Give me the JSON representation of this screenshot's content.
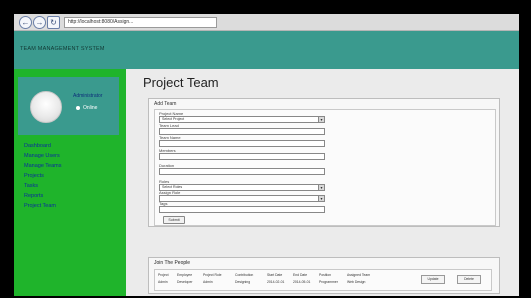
{
  "browser": {
    "address": "http://localhost:8080/Assign..."
  },
  "header": {
    "title": "TEAM MANAGEMENT SYSTEM"
  },
  "sidebar": {
    "profile": {
      "name": "Administrator",
      "status": "Online"
    },
    "items": [
      {
        "label": "Dashboard"
      },
      {
        "label": "Manage Users"
      },
      {
        "label": "Manage Teams"
      },
      {
        "label": "Projects"
      },
      {
        "label": "Tasks"
      },
      {
        "label": "Reports"
      },
      {
        "label": "Project Team"
      }
    ]
  },
  "main": {
    "title": "Project Team",
    "add_panel": {
      "title": "Add Team",
      "fields": [
        {
          "label": "Project Name",
          "value": "Select Project",
          "type": "select"
        },
        {
          "label": "Team Lead",
          "value": "",
          "type": "text"
        },
        {
          "label": "Team Name",
          "value": "",
          "type": "text"
        },
        {
          "label": "Members",
          "value": "",
          "type": "text"
        },
        {
          "label": "Duration",
          "value": "",
          "type": "text"
        },
        {
          "label": "Roles",
          "value": "Select Roles",
          "type": "select"
        },
        {
          "label": "Assign Role",
          "value": "",
          "type": "select"
        },
        {
          "label": "Tags",
          "value": "",
          "type": "text"
        }
      ],
      "submit_label": "Submit"
    },
    "join_panel": {
      "title": "Join The People",
      "columns": [
        "Project",
        "Employee",
        "Project Role",
        "Contribution",
        "Start Date",
        "End Date",
        "Position",
        "Assigned Team"
      ],
      "rows": [
        [
          "Admin",
          "Developer",
          "Admin",
          "Designing",
          "2014-02-01",
          "2014-05-01",
          "Programmer",
          "Web Design"
        ]
      ],
      "edit_label": "Update",
      "delete_label": "Delete"
    }
  }
}
